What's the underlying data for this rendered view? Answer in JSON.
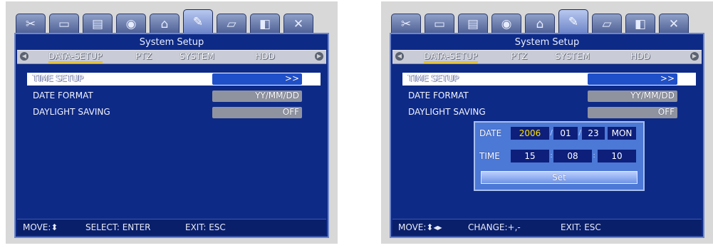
{
  "tabs": [
    {
      "icon": "tools-icon",
      "glyph": "✂"
    },
    {
      "icon": "monitor-icon",
      "glyph": "▭"
    },
    {
      "icon": "disk-icon",
      "glyph": "▤"
    },
    {
      "icon": "camera-icon",
      "glyph": "◉"
    },
    {
      "icon": "network-icon",
      "glyph": "⌂"
    },
    {
      "icon": "system-icon",
      "glyph": "✎"
    },
    {
      "icon": "folder-icon",
      "glyph": "▱"
    },
    {
      "icon": "record-icon",
      "glyph": "◧"
    },
    {
      "icon": "close-icon",
      "glyph": "✕"
    }
  ],
  "left": {
    "title": "System Setup",
    "menu": [
      "DATA-SETUP",
      "PTZ",
      "SYSTEM",
      "HDD"
    ],
    "rows": [
      {
        "label": "TIME SETUP",
        "value": ">>"
      },
      {
        "label": "DATE FORMAT",
        "value": "YY/MM/DD"
      },
      {
        "label": "DAYLIGHT SAVING",
        "value": "OFF"
      }
    ],
    "footer": {
      "move": "MOVE:",
      "move_icon": "⬍",
      "select": "SELECT: ENTER",
      "exit": "EXIT: ESC"
    }
  },
  "right": {
    "title": "System Setup",
    "menu": [
      "DATA-SETUP",
      "PTZ",
      "SYSTEM",
      "HDD"
    ],
    "rows": [
      {
        "label": "TIME SETUP",
        "value": ">>"
      },
      {
        "label": "DATE FORMAT",
        "value": "YY/MM/DD"
      },
      {
        "label": "DAYLIGHT SAVING",
        "value": "OFF"
      }
    ],
    "dialog": {
      "date_label": "DATE",
      "year": "2006",
      "month": "01",
      "day": "23",
      "weekday": "MON",
      "time_label": "TIME",
      "hour": "15",
      "minute": "08",
      "second": "10",
      "set_label": "Set"
    },
    "footer": {
      "move": "MOVE:",
      "move_icon": "⬍◂▸",
      "change": "CHANGE:+,-",
      "exit": "EXIT: ESC"
    }
  },
  "colors": {
    "screen_bg": "#0e2a87",
    "highlight": "#1f4fc9",
    "dialog_bg": "#4c78d6",
    "year_text": "#ffe000"
  }
}
